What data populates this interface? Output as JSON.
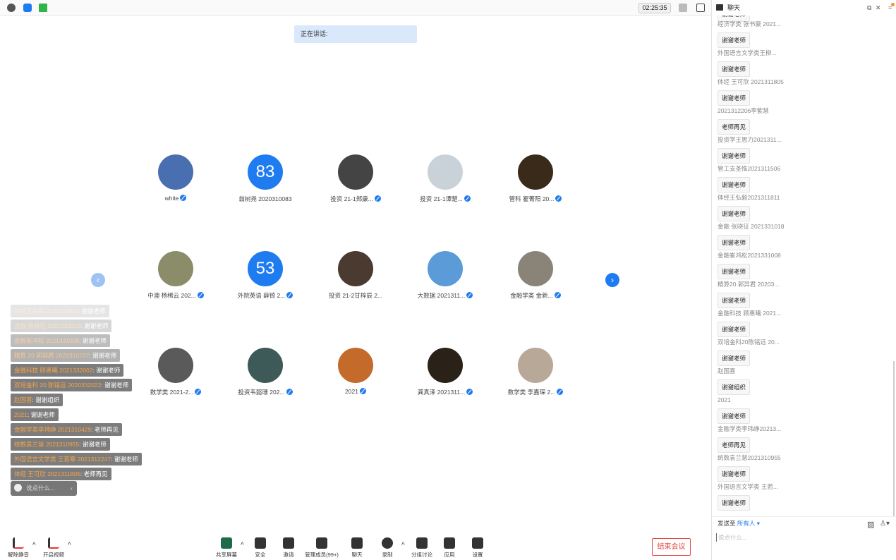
{
  "topbar": {
    "timer": "02:25:35",
    "icons": [
      "info-icon",
      "shield-icon",
      "signal-icon",
      "fullscreen-icon",
      "layout-icon"
    ]
  },
  "speaking": "正在讲话:",
  "participants": [
    {
      "name": "white",
      "avatar": "image",
      "color": "#4a6fb0",
      "mic": true
    },
    {
      "name": "翁树尧 2020310083",
      "avatar": "83",
      "color": "#1f7cf0",
      "mic": false
    },
    {
      "name": "投资 21-1郑康...",
      "avatar": "image",
      "color": "#444",
      "mic": true
    },
    {
      "name": "投资 21-1谭楚...",
      "avatar": "image",
      "color": "#c9d2d8",
      "mic": true
    },
    {
      "name": "管科 翟菁阳 20...",
      "avatar": "image",
      "color": "#3a2a1a",
      "mic": true
    },
    {
      "name": "中澳 杨稀云 202...",
      "avatar": "image",
      "color": "#8b8d6a",
      "mic": true
    },
    {
      "name": "外院英语 薛锜 2...",
      "avatar": "53",
      "color": "#1f7cf0",
      "mic": true
    },
    {
      "name": "投资 21-2甘梓辰 2...",
      "avatar": "image",
      "color": "#4a3a30",
      "mic": false
    },
    {
      "name": "大数据 2021311...",
      "avatar": "image",
      "color": "#5b9bd8",
      "mic": true
    },
    {
      "name": "金融学类 金新...",
      "avatar": "image",
      "color": "#8a8478",
      "mic": true
    },
    {
      "name": "数学类 2021-2...",
      "avatar": "image",
      "color": "#5a5a5a",
      "mic": true
    },
    {
      "name": "投资韦懿珊 202...",
      "avatar": "image",
      "color": "#3d5a58",
      "mic": true
    },
    {
      "name": "2021",
      "avatar": "image",
      "color": "#c46a2a",
      "mic": true
    },
    {
      "name": "龚真泽 2021311...",
      "avatar": "image",
      "color": "#2a2218",
      "mic": true
    },
    {
      "name": "数学类 李嘉琛 2...",
      "avatar": "image",
      "color": "#b8a898",
      "mic": true
    }
  ],
  "overlay_messages": [
    {
      "who": "体经王弘毅 2021311811",
      "text": "谢谢老师",
      "fade": 0.2
    },
    {
      "who": "金融 张晓征 2021331018",
      "text": "谢谢老师",
      "fade": 0.3
    },
    {
      "who": "金融崔鸿松 2021331008",
      "text": "谢谢老师",
      "fade": 0.5
    },
    {
      "who": "精算 20 郭羿君 2020310737",
      "text": "谢谢老师",
      "fade": 0.6
    },
    {
      "who": "金融科技 顾惠曦 2021332002",
      "text": "谢谢老师",
      "fade": 1
    },
    {
      "who": "双培金科 20 陈铭远 2020332022",
      "text": "谢谢老师",
      "fade": 1
    },
    {
      "who": "赵国喜",
      "text": "谢谢组织",
      "fade": 1
    },
    {
      "who": "2021",
      "text": "谢谢老师",
      "fade": 1
    },
    {
      "who": "金融学类李玮峥 2021310429",
      "text": "老师再见",
      "fade": 1
    },
    {
      "who": "统数袁兰慧 2021310955",
      "text": "谢谢老师",
      "fade": 1
    },
    {
      "who": "外国语言文学类 王若寒 2021312247",
      "text": "谢谢老师",
      "fade": 1
    },
    {
      "who": "体经 王可欣 2021311805",
      "text": "老师再见",
      "fade": 1
    }
  ],
  "overlay_input_placeholder": "说点什么...",
  "toolbar": [
    {
      "label": "解除静音",
      "icon": "mic-muted-icon"
    },
    {
      "label": "开启视频",
      "icon": "video-off-icon"
    },
    {
      "label": "共享屏幕",
      "icon": "share-screen-icon"
    },
    {
      "label": "安全",
      "icon": "security-icon"
    },
    {
      "label": "邀请",
      "icon": "invite-icon"
    },
    {
      "label": "管理成员(99+)",
      "icon": "members-icon"
    },
    {
      "label": "聊天",
      "icon": "chat-icon"
    },
    {
      "label": "录制",
      "icon": "record-icon"
    },
    {
      "label": "分组讨论",
      "icon": "breakout-icon"
    },
    {
      "label": "应用",
      "icon": "apps-icon"
    },
    {
      "label": "设置",
      "icon": "settings-icon"
    }
  ],
  "end_meeting": "结束会议",
  "chat": {
    "title": "聊天",
    "messages": [
      {
        "name": "",
        "text": "谢谢老师"
      },
      {
        "name": "经济学类 张书豪 2021...",
        "text": "谢谢老师"
      },
      {
        "name": "外国语言文学类王柳...",
        "text": "谢谢老师"
      },
      {
        "name": "体经 王可欣 2021311805",
        "text": "谢谢老师"
      },
      {
        "name": "2021312206李紫慧",
        "text": "老师再见"
      },
      {
        "name": "投资学王思力2021311...",
        "text": "谢谢老师"
      },
      {
        "name": "管工支圣惟2021311506",
        "text": "谢谢老师"
      },
      {
        "name": "体经王弘毅2021311811",
        "text": "谢谢老师"
      },
      {
        "name": "金融 张晓征 2021331018",
        "text": "谢谢老师"
      },
      {
        "name": "金融崔鸿松2021331008",
        "text": "谢谢老师"
      },
      {
        "name": "精算20 郭羿君 20203...",
        "text": "谢谢老师"
      },
      {
        "name": "金融科技 顾惠曦 2021...",
        "text": "谢谢老师"
      },
      {
        "name": "双培金科20陈铭远 20...",
        "text": "谢谢老师"
      },
      {
        "name": "赵国喜",
        "text": "谢谢组织"
      },
      {
        "name": "2021",
        "text": "谢谢老师"
      },
      {
        "name": "金融学类李玮峥20213...",
        "text": "老师再见"
      },
      {
        "name": "统数袁兰慧2021310955",
        "text": "谢谢老师"
      },
      {
        "name": "外国语言文学类 王若...",
        "text": "谢谢老师"
      }
    ],
    "send_to_label": "发送至",
    "send_to_value": "所有人",
    "input_placeholder": "说点什么..."
  }
}
